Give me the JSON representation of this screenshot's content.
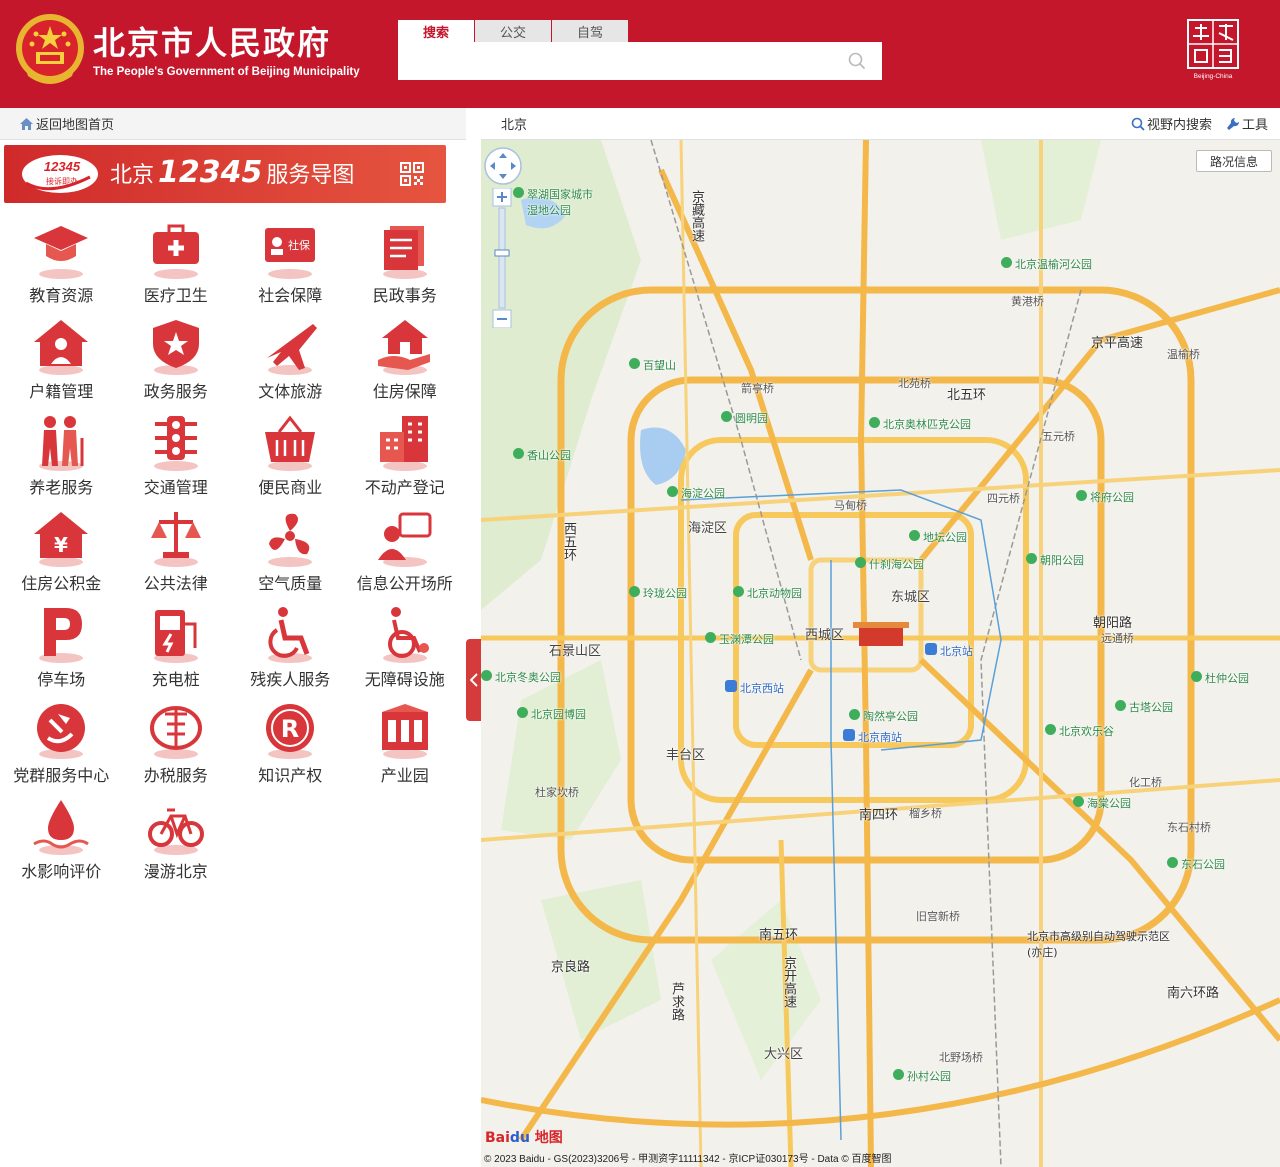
{
  "header": {
    "title": "北京市人民政府",
    "subtitle": "The People's Government of Beijing Municipality",
    "search_tabs": [
      "搜索",
      "公交",
      "自驾"
    ],
    "search_placeholder": "",
    "capital_logo_text": "Beijing-China"
  },
  "left": {
    "back_link": "返回地图首页",
    "banner": {
      "prefix": "北京",
      "number": "12345",
      "suffix": "服务导图",
      "badge_number": "12345",
      "badge_text": "接诉即办"
    },
    "services": [
      {
        "label": "教育资源",
        "icon": "graduation-cap-icon"
      },
      {
        "label": "医疗卫生",
        "icon": "medical-kit-icon"
      },
      {
        "label": "社会保障",
        "icon": "social-security-card-icon"
      },
      {
        "label": "民政事务",
        "icon": "documents-icon"
      },
      {
        "label": "户籍管理",
        "icon": "household-icon"
      },
      {
        "label": "政务服务",
        "icon": "badge-icon"
      },
      {
        "label": "文体旅游",
        "icon": "airplane-icon"
      },
      {
        "label": "住房保障",
        "icon": "house-hand-icon"
      },
      {
        "label": "养老服务",
        "icon": "elderly-icon"
      },
      {
        "label": "交通管理",
        "icon": "traffic-light-icon"
      },
      {
        "label": "便民商业",
        "icon": "shopping-basket-icon"
      },
      {
        "label": "不动产登记",
        "icon": "buildings-icon"
      },
      {
        "label": "住房公积金",
        "icon": "housing-fund-icon"
      },
      {
        "label": "公共法律",
        "icon": "scales-icon"
      },
      {
        "label": "空气质量",
        "icon": "fan-icon"
      },
      {
        "label": "信息公开场所",
        "icon": "info-speaker-icon"
      },
      {
        "label": "停车场",
        "icon": "parking-icon"
      },
      {
        "label": "充电桩",
        "icon": "charging-pile-icon"
      },
      {
        "label": "残疾人服务",
        "icon": "wheelchair-icon"
      },
      {
        "label": "无障碍设施",
        "icon": "accessible-icon"
      },
      {
        "label": "党群服务中心",
        "icon": "party-emblem-icon"
      },
      {
        "label": "办税服务",
        "icon": "tax-icon"
      },
      {
        "label": "知识产权",
        "icon": "registered-icon"
      },
      {
        "label": "产业园",
        "icon": "industrial-park-icon"
      },
      {
        "label": "水影响评价",
        "icon": "water-icon"
      },
      {
        "label": "漫游北京",
        "icon": "bicycle-icon"
      }
    ]
  },
  "map": {
    "city": "北京",
    "tools": [
      "视野内搜索",
      "工具"
    ],
    "traffic_button": "路况信息",
    "labels": {
      "haidian": "海淀区",
      "xicheng": "西城区",
      "dongcheng": "东城区",
      "shijingshan": "石景山区",
      "fengtai": "丰台区",
      "daxing": "大兴区",
      "chaoyang_road": "朝阳路",
      "north5": "北五环",
      "south4": "南四环",
      "south5": "南五环",
      "south6": "南六环路",
      "jingping": "京平高速",
      "jingzang": "京藏高速",
      "jingkai": "京开高速",
      "jingliang": "京良路",
      "luqiu": "芦求路",
      "xiwuhuan": "西五环",
      "p1": "北京温榆河公园",
      "p2": "百望山",
      "p3": "圆明园",
      "p4": "北京奥林匹克公园",
      "p5": "香山公园",
      "p6": "海淀公园",
      "p7": "地坛公园",
      "p8": "什刹海公园",
      "p9": "北京动物园",
      "p10": "玲珑公园",
      "p11": "玉渊潭公园",
      "p12": "朝阳公园",
      "p13": "将府公园",
      "p14": "陶然亭公园",
      "p15": "北京园博园",
      "p16": "北京欢乐谷",
      "p17": "海棠公园",
      "p18": "东石公园",
      "p19": "杜仲公园",
      "p20": "孙村公园",
      "p21": "古塔公园",
      "p22": "翠湖国家城市湿地公园",
      "p23": "北京冬奥公园",
      "s1": "北京站",
      "s2": "北京西站",
      "s3": "北京南站",
      "b1": "箭亭桥",
      "b2": "北苑桥",
      "b3": "黄港桥",
      "b4": "五元桥",
      "b5": "四元桥",
      "b6": "马甸桥",
      "b7": "远通桥",
      "b8": "化工桥",
      "b9": "东石村桥",
      "b10": "旧宫新桥",
      "b11": "北野场桥",
      "b12": "杜家坎桥",
      "b13": "榴乡桥",
      "b14": "温榆桥",
      "bjhad": "北京市高级别自动驾驶示范区(亦庄)"
    },
    "copyright": "© 2023 Baidu - GS(2023)3206号 - 甲测资字11111342 - 京ICP证030173号 - Data © 百度智图"
  }
}
